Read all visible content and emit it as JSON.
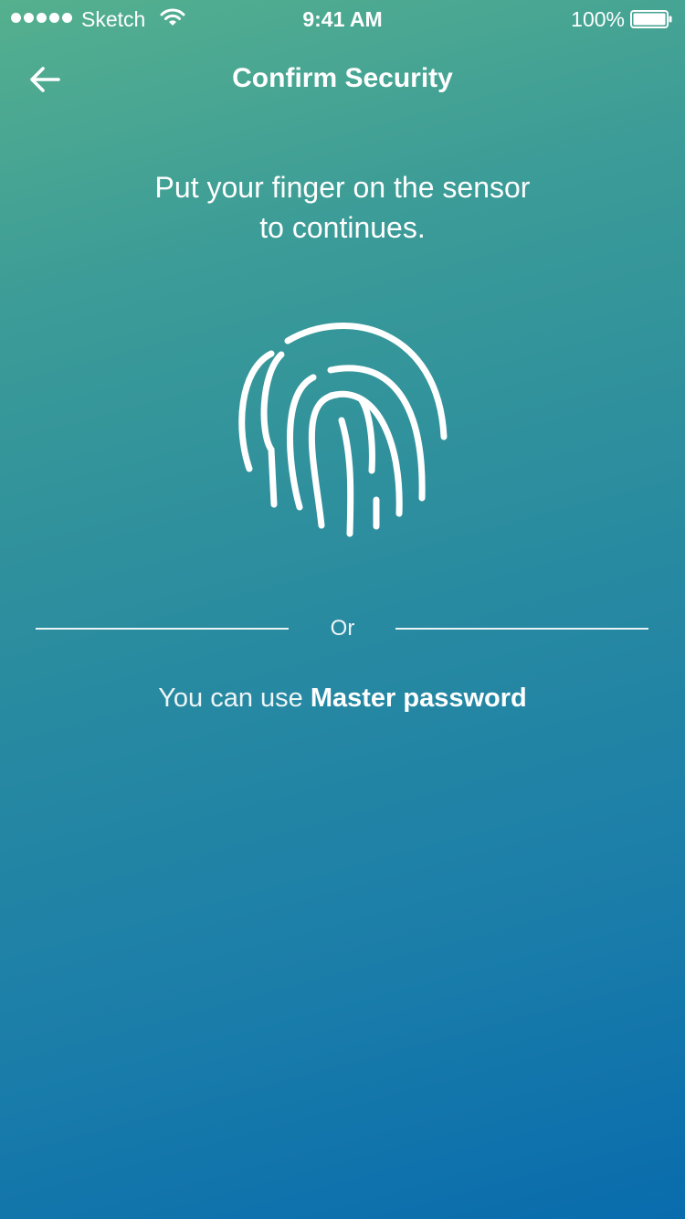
{
  "status_bar": {
    "carrier": "Sketch",
    "time": "9:41 AM",
    "battery_percent": "100%",
    "signal_bars": 5,
    "battery_level": 1.0,
    "icons": [
      "signal-dots-icon",
      "wifi-icon",
      "battery-icon"
    ]
  },
  "nav": {
    "title": "Confirm Security",
    "back_icon": "arrow-left-icon"
  },
  "instruction": {
    "line1": "Put your finger on the sensor",
    "line2": "to continues."
  },
  "fingerprint": {
    "icon": "fingerprint-icon"
  },
  "divider": {
    "label": "Or"
  },
  "alternative": {
    "prefix": "You can use",
    "link_label": "Master password"
  },
  "colors": {
    "gradient_start": "#55b08e",
    "gradient_end": "#096cad",
    "foreground": "#ffffff"
  }
}
